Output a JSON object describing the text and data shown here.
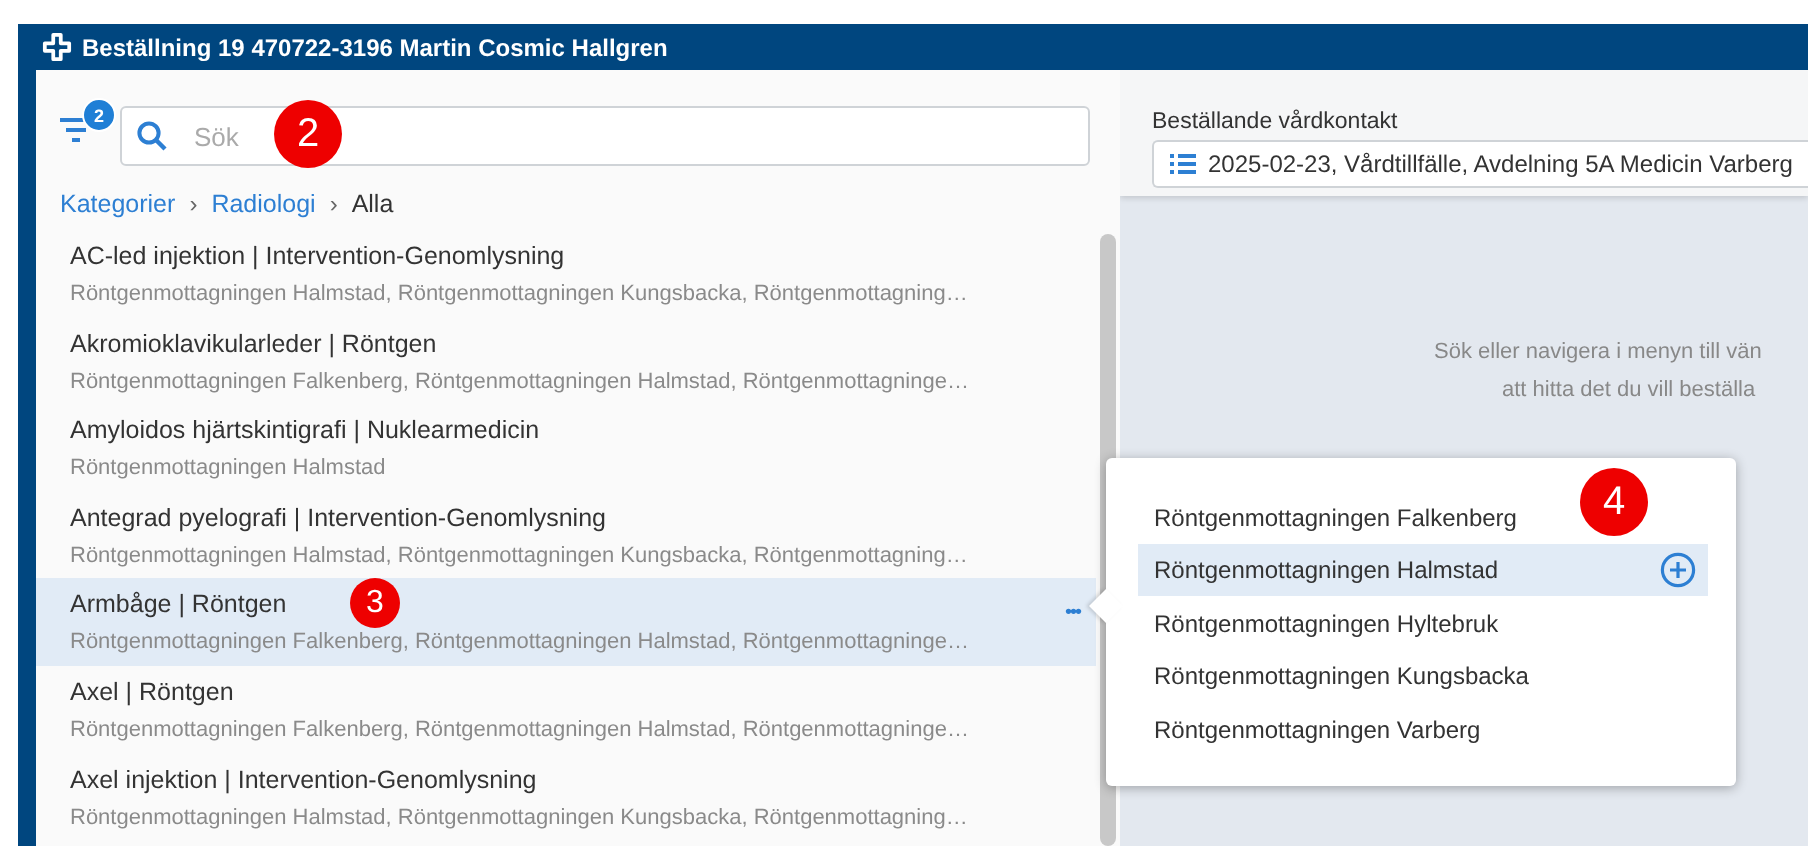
{
  "window": {
    "title": "Beställning 19 470722-3196 Martin Cosmic Hallgren"
  },
  "filter": {
    "badge": "2"
  },
  "search": {
    "placeholder": "Sök",
    "callout": "2"
  },
  "breadcrumb": [
    {
      "label": "Kategorier",
      "kind": "link"
    },
    {
      "separator": "›",
      "label": "Radiologi",
      "kind": "link"
    },
    {
      "separator": "›",
      "label": "Alla",
      "kind": "current"
    }
  ],
  "rows": [
    {
      "title": "AC-led injektion | Intervention-Genomlysning",
      "locations": "Röntgenmottagningen Halmstad, Röntgenmottagningen Kungsbacka, Röntgenmottagning…",
      "selected": false
    },
    {
      "title": "Akromioklavikularleder | Röntgen",
      "locations": "Röntgenmottagningen Falkenberg, Röntgenmottagningen Halmstad, Röntgenmottagninge…",
      "selected": false
    },
    {
      "title": "Amyloidos hjärtskintigrafi | Nuklearmedicin",
      "locations": "Röntgenmottagningen Halmstad",
      "selected": false
    },
    {
      "title": "Antegrad pyelografi | Intervention-Genomlysning",
      "locations": "Röntgenmottagningen Halmstad, Röntgenmottagningen Kungsbacka, Röntgenmottagning…",
      "selected": false
    },
    {
      "title": "Armbåge | Röntgen",
      "locations": "Röntgenmottagningen Falkenberg, Röntgenmottagningen Halmstad, Röntgenmottagninge…",
      "selected": true,
      "more": "•••",
      "callout": "3"
    },
    {
      "title": "Axel | Röntgen",
      "locations": "Röntgenmottagningen Falkenberg, Röntgenmottagningen Halmstad, Röntgenmottagninge…",
      "selected": false
    },
    {
      "title": "Axel injektion | Intervention-Genomlysning",
      "locations": "Röntgenmottagningen Halmstad, Röntgenmottagningen Kungsbacka, Röntgenmottagning…",
      "selected": false
    }
  ],
  "popup": {
    "callout": "4",
    "items": [
      {
        "label": "Röntgenmottagningen Falkenberg",
        "selected": false
      },
      {
        "label": "Röntgenmottagningen Halmstad",
        "selected": true
      },
      {
        "label": "Röntgenmottagningen Hyltebruk",
        "selected": false
      },
      {
        "label": "Röntgenmottagningen Kungsbacka",
        "selected": false
      },
      {
        "label": "Röntgenmottagningen Varberg",
        "selected": false
      }
    ]
  },
  "care_contact": {
    "label": "Beställande vårdkontakt",
    "value": "2025-02-23, Vårdtillfälle, Avdelning 5A Medicin Varberg"
  },
  "empty_message": [
    "Sök eller navigera i menyn till vän",
    "att hitta det du vill beställa"
  ]
}
